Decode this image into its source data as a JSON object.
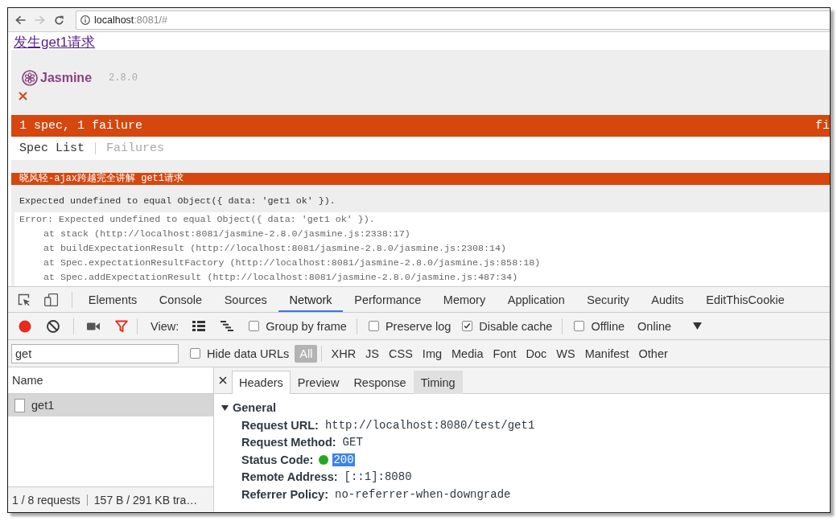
{
  "browser": {
    "nav": [
      {
        "kind": "back",
        "disabled": false
      },
      {
        "kind": "forward",
        "disabled": true
      },
      {
        "kind": "reload",
        "disabled": false
      }
    ],
    "url_host": "localhost",
    "url_rest": ":8081/#"
  },
  "page": {
    "link": "发生get1请求",
    "jasmine": {
      "logo_text": "Jasmine",
      "version": "2.8.0",
      "specs": [
        {
          "failed": true
        }
      ],
      "summary": "1 spec, 1 failure",
      "summary_tail": "fi",
      "menu": [
        {
          "label": "Spec List",
          "selected": true
        },
        {
          "label": "Failures",
          "selected": false
        }
      ],
      "failure": {
        "title": "晓风轻-ajax跨越完全讲解 get1请求",
        "message": "Expected undefined to equal Object({ data: 'get1 ok' }).",
        "error": "Error: Expected undefined to equal Object({ data: 'get1 ok' }).",
        "frames": [
          "at stack (http://localhost:8081/jasmine-2.8.0/jasmine.js:2338:17)",
          "at buildExpectationResult (http://localhost:8081/jasmine-2.8.0/jasmine.js:2308:14)",
          "at Spec.expectationResultFactory (http://localhost:8081/jasmine-2.8.0/jasmine.js:858:18)",
          "at Spec.addExpectationResult (http://localhost:8081/jasmine-2.8.0/jasmine.js:487:34)"
        ]
      }
    }
  },
  "devtools": {
    "panel_tabs": [
      {
        "label": "Elements",
        "selected": false
      },
      {
        "label": "Console",
        "selected": false
      },
      {
        "label": "Sources",
        "selected": false
      },
      {
        "label": "Network",
        "selected": true
      },
      {
        "label": "Performance",
        "selected": false
      },
      {
        "label": "Memory",
        "selected": false
      },
      {
        "label": "Application",
        "selected": false
      },
      {
        "label": "Security",
        "selected": false
      },
      {
        "label": "Audits",
        "selected": false
      },
      {
        "label": "EditThisCookie",
        "selected": false
      }
    ],
    "toolbar": {
      "recording": true,
      "filter_on": true,
      "view_label": "View:",
      "option_groups": [
        {
          "options": [
            {
              "label": "Group by frame",
              "checked": false
            }
          ]
        },
        {
          "options": [
            {
              "label": "Preserve log",
              "checked": false
            },
            {
              "label": "Disable cache",
              "checked": true
            }
          ]
        },
        {
          "options": [
            {
              "label": "Offline",
              "checked": false
            }
          ]
        }
      ],
      "throttling": "Online"
    },
    "filter": {
      "query": "get",
      "hide_data_urls": {
        "label": "Hide data URLs",
        "checked": false
      },
      "types": [
        {
          "label": "All",
          "selected": true
        },
        {
          "label": "XHR",
          "selected": false
        },
        {
          "label": "JS",
          "selected": false
        },
        {
          "label": "CSS",
          "selected": false
        },
        {
          "label": "Img",
          "selected": false
        },
        {
          "label": "Media",
          "selected": false
        },
        {
          "label": "Font",
          "selected": false
        },
        {
          "label": "Doc",
          "selected": false
        },
        {
          "label": "WS",
          "selected": false
        },
        {
          "label": "Manifest",
          "selected": false
        },
        {
          "label": "Other",
          "selected": false
        }
      ]
    },
    "requests": {
      "column": "Name",
      "rows": [
        {
          "name": "get1",
          "selected": true
        }
      ],
      "summary": [
        "1 / 8 requests",
        "157 B / 291 KB tra…"
      ]
    },
    "details": {
      "tabs": [
        {
          "label": "Headers",
          "selected": true,
          "hovered": false
        },
        {
          "label": "Preview",
          "selected": false,
          "hovered": false
        },
        {
          "label": "Response",
          "selected": false,
          "hovered": false
        },
        {
          "label": "Timing",
          "selected": false,
          "hovered": true
        }
      ],
      "section": {
        "title": "General",
        "expanded": true,
        "rows": [
          {
            "kind": "plain",
            "key": "Request URL:",
            "value": "http://localhost:8080/test/get1",
            "value_selected": false
          },
          {
            "kind": "plain",
            "key": "Request Method:",
            "value": "GET",
            "value_selected": false
          },
          {
            "kind": "status",
            "key": "Status Code:",
            "value": "200",
            "color": "#22a822",
            "value_selected": true
          },
          {
            "kind": "plain",
            "key": "Remote Address:",
            "value": "[::1]:8080",
            "value_selected": false
          },
          {
            "kind": "plain",
            "key": "Referrer Policy:",
            "value": "no-referrer-when-downgrade",
            "value_selected": false
          }
        ]
      }
    }
  }
}
